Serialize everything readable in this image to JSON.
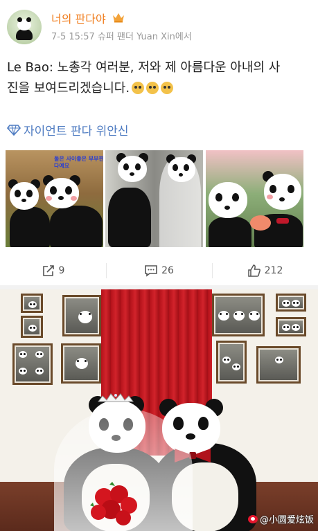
{
  "post": {
    "username": "너의 판다야",
    "meta": "7-5 15:57 슈퍼 팬더 Yuan Xin에서",
    "text": "Le Bao: 노총각 여러분, 저와 제 아름다운 아내의 사진을 보여드리겠습니다.",
    "text_line1": "Le Bao: 노총각 여러분, 저와 제 아름다운 아내의 사",
    "text_line2": "진을 보여드리겠습니다.",
    "topic": "자이언트 판다 위안신",
    "thumbnail_caption": "둘은 사이좋은 부부판다예요",
    "actions": {
      "repost": "9",
      "comments": "26",
      "likes": "212"
    }
  },
  "image": {
    "watermark": "@小圆爱炫饭"
  },
  "colors": {
    "username": "#f07b1a",
    "topic": "#4f7cc2",
    "meta": "#999999",
    "curtain": "#c21b22"
  },
  "icons": [
    "vip-crown-icon",
    "diamond-topic-icon",
    "repost-icon",
    "comment-icon",
    "like-icon",
    "weibo-logo-icon"
  ]
}
